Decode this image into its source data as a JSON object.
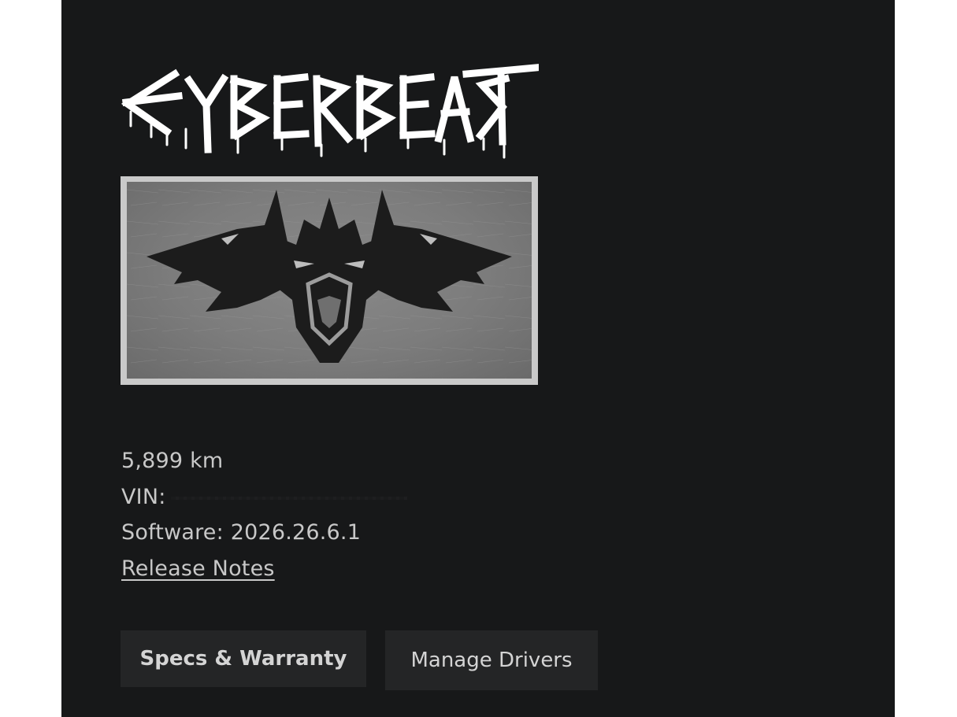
{
  "vehicle": {
    "name": "CYBERBEAST",
    "odometer": "5,899 km",
    "vin_label": "VIN:",
    "software": "Software: 2026.26.6.1",
    "release_notes_link": "Release Notes"
  },
  "badge": {
    "icon": "three-headed-beast-emblem"
  },
  "actions": {
    "specs_label": "Specs & Warranty",
    "drivers_label": "Manage Drivers"
  },
  "colors": {
    "background": "#171819",
    "text": "#c8c8c8",
    "button": "#242526"
  }
}
